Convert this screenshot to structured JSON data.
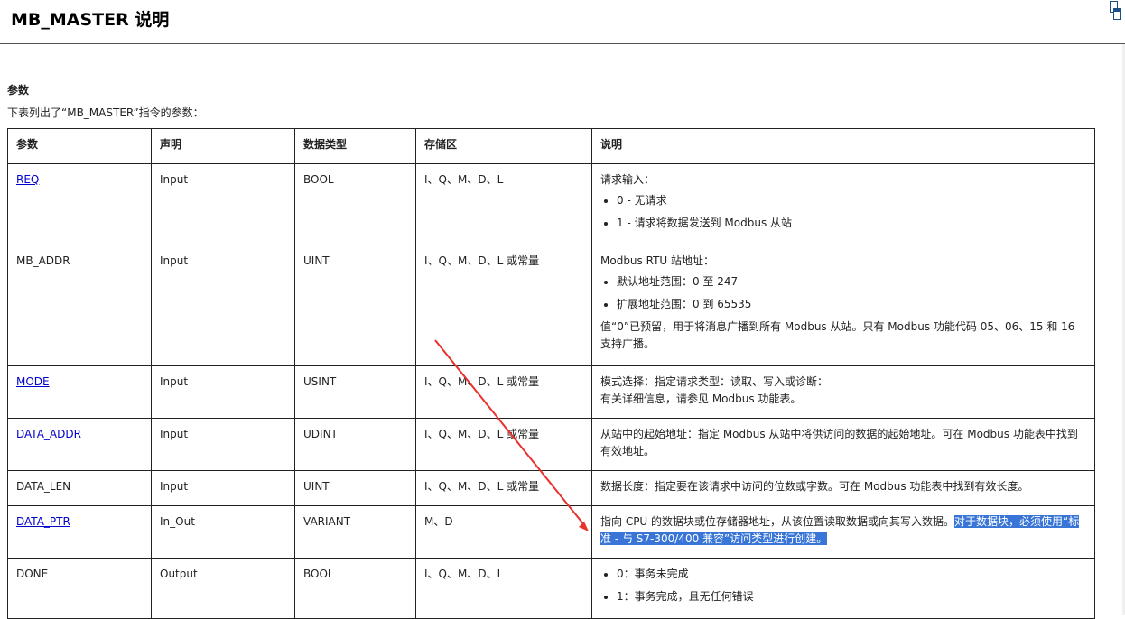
{
  "header": {
    "title": "MB_MASTER 说明"
  },
  "section": {
    "label": "参数",
    "intro": "下表列出了“MB_MASTER”指令的参数："
  },
  "table": {
    "headers": [
      "参数",
      "声明",
      "数据类型",
      "存储区",
      "说明"
    ],
    "rows": [
      {
        "param": "REQ",
        "link": true,
        "decl": "Input",
        "type": "BOOL",
        "area": "I、Q、M、D、L",
        "desc_lines": [
          "请求输入："
        ],
        "bullets": [
          "0 - 无请求",
          "1 - 请求将数据发送到 Modbus 从站"
        ]
      },
      {
        "param": "MB_ADDR",
        "link": false,
        "decl": "Input",
        "type": "UINT",
        "area": "I、Q、M、D、L 或常量",
        "desc_lines": [
          "Modbus RTU 站地址："
        ],
        "bullets": [
          "默认地址范围：0 至 247",
          "扩展地址范围：0 到 65535"
        ],
        "desc_after": "值“0”已预留，用于将消息广播到所有 Modbus 从站。只有 Modbus 功能代码 05、06、15 和 16 支持广播。"
      },
      {
        "param": "MODE",
        "link": true,
        "decl": "Input",
        "type": "USINT",
        "area": "I、Q、M、D、L 或常量",
        "desc_lines": [
          "模式选择：指定请求类型：读取、写入或诊断：",
          "有关详细信息，请参见 Modbus 功能表。"
        ]
      },
      {
        "param": "DATA_ADDR",
        "link": true,
        "decl": "Input",
        "type": "UDINT",
        "area": "I、Q、M、D、L 或常量",
        "desc_lines": [
          "从站中的起始地址：指定 Modbus 从站中将供访问的数据的起始地址。可在 Modbus 功能表中找到有效地址。"
        ]
      },
      {
        "param": "DATA_LEN",
        "link": false,
        "decl": "Input",
        "type": "UINT",
        "area": "I、Q、M、D、L 或常量",
        "desc_lines": [
          "数据长度：指定要在该请求中访问的位数或字数。可在 Modbus 功能表中找到有效长度。"
        ]
      },
      {
        "param": "DATA_PTR",
        "link": true,
        "decl": "In_Out",
        "type": "VARIANT",
        "area": "M、D",
        "desc_plain": "指向 CPU 的数据块或位存储器地址，从该位置读取数据或向其写入数据。",
        "desc_highlight": "对于数据块，必须使用“标准 - 与 S7-300/400 兼容”访问类型进行创建。"
      },
      {
        "param": "DONE",
        "link": false,
        "decl": "Output",
        "type": "BOOL",
        "area": "I、Q、M、D、L",
        "bullets": [
          "0：事务未完成",
          "1：事务完成，且无任何错误"
        ]
      }
    ]
  },
  "colors": {
    "link": "#0000cc",
    "highlight": "#3875d7",
    "arrow": "#e8322d"
  }
}
